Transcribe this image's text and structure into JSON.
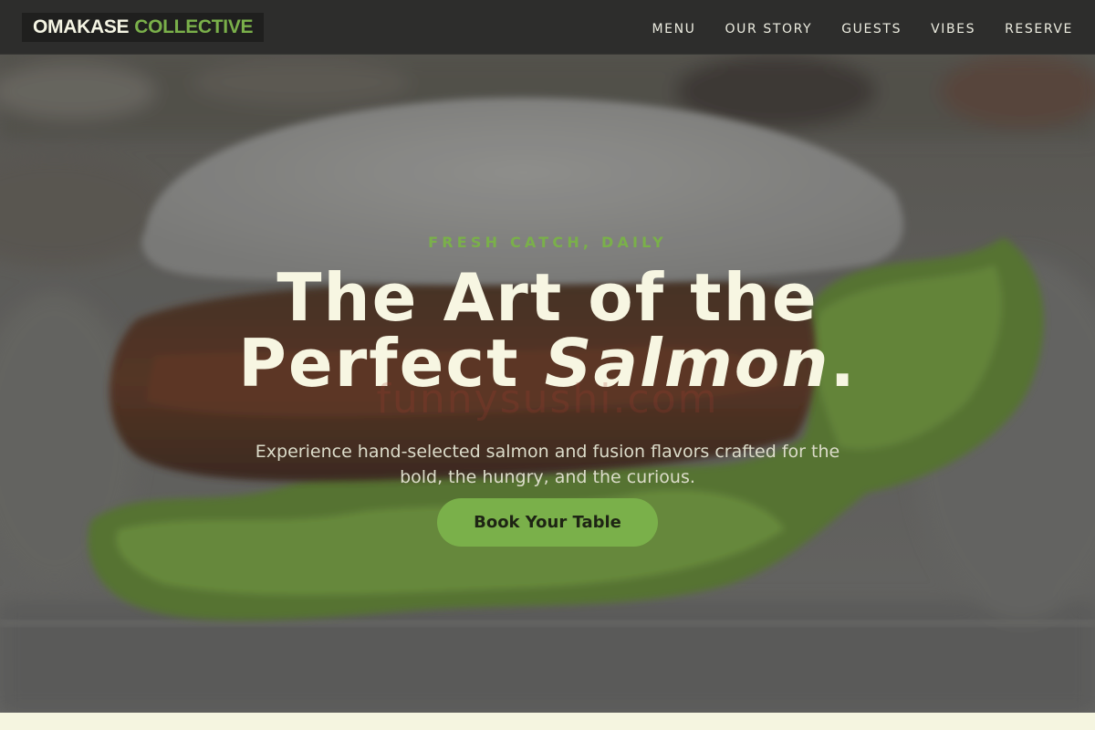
{
  "brand": {
    "name_part1": "OMAKASE",
    "name_part2": "COLLECTIVE",
    "accent_color": "#7ab04a"
  },
  "nav": {
    "items": [
      {
        "label": "MENU"
      },
      {
        "label": "OUR STORY"
      },
      {
        "label": "GUESTS"
      },
      {
        "label": "VIBES"
      },
      {
        "label": "RESERVE"
      }
    ]
  },
  "hero": {
    "eyebrow": "FRESH CATCH, DAILY",
    "headline_line1": "The Art of the",
    "headline_line2_prefix": "Perfect ",
    "headline_line2_emphasis": "Salmon",
    "headline_line2_suffix": ".",
    "subtitle": "Experience hand-selected salmon and fusion flavors crafted for the bold, the hungry, and the curious.",
    "cta_label": "Book Your Table",
    "background_image": "blurred close-up of a salmon sushi bun with lettuce",
    "watermark": "funnysushi.com"
  },
  "colors": {
    "nav_background": "#2d2d2c",
    "headline_color": "#f7f6e2",
    "page_background": "#f5f5e0"
  }
}
